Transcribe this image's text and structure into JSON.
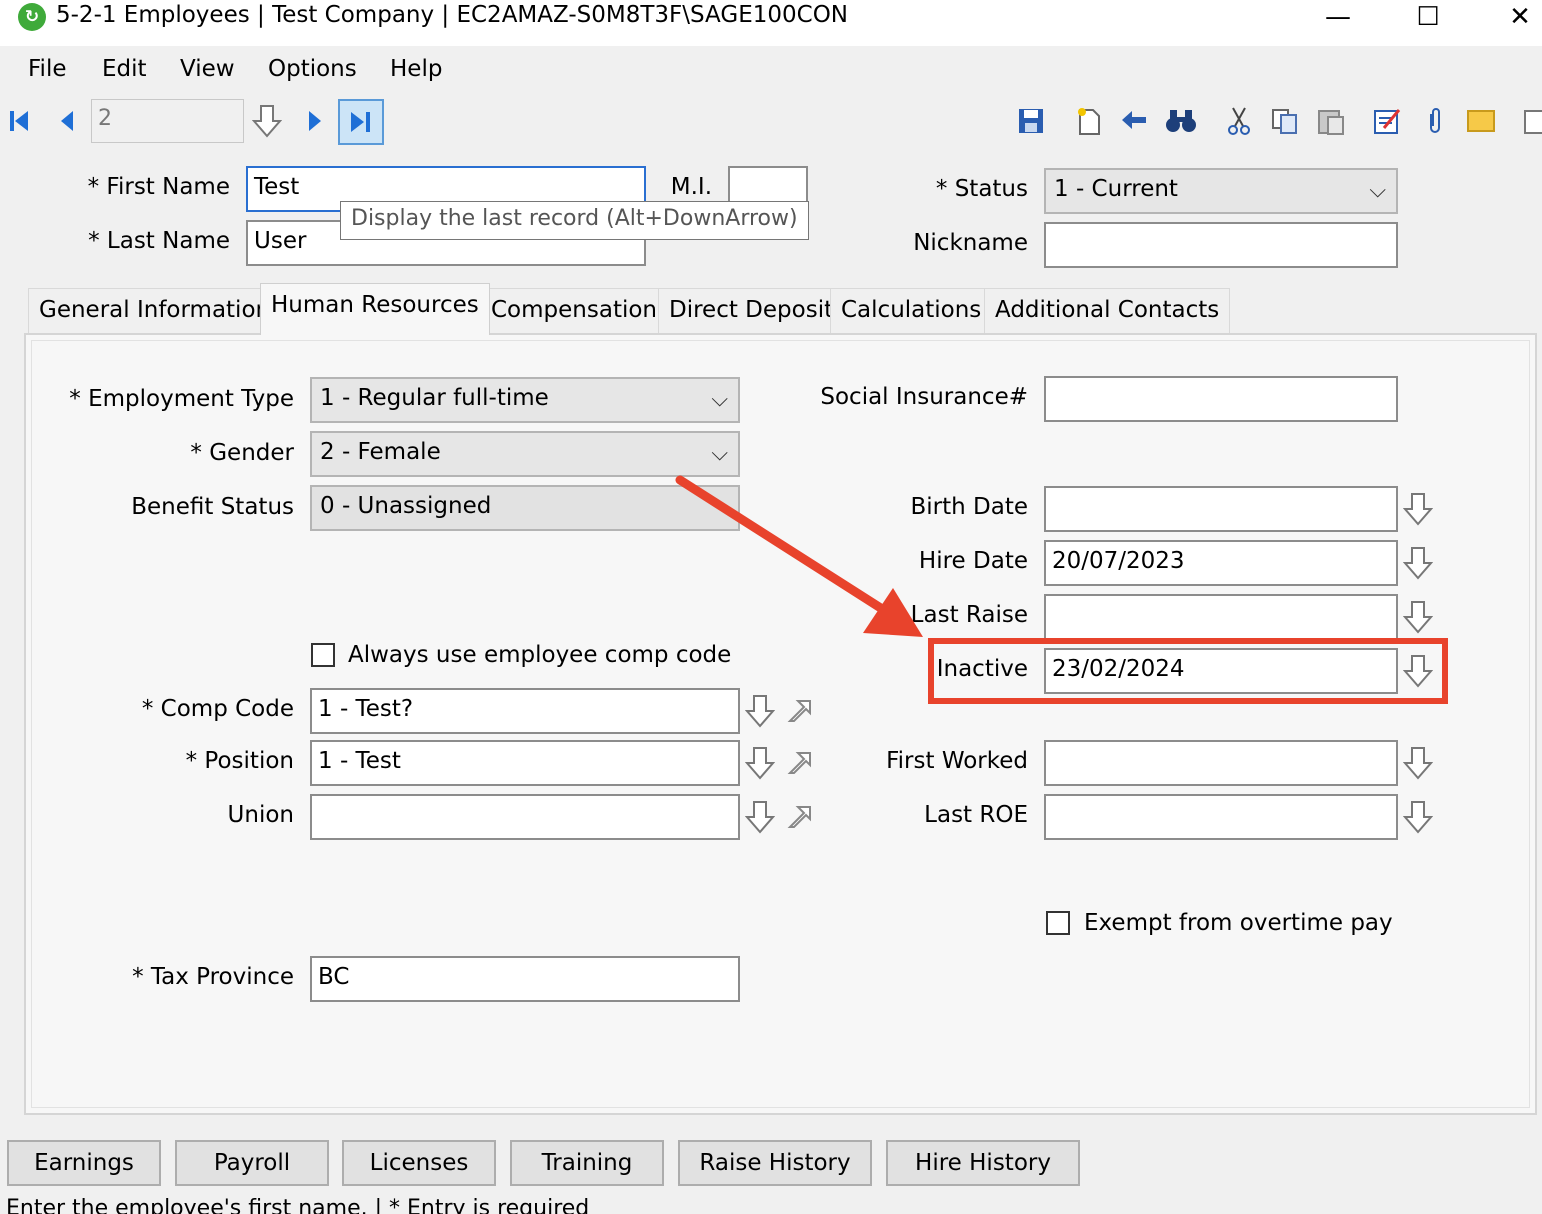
{
  "window": {
    "title": "5-2-1 Employees  |  Test Company  |  EC2AMAZ-S0M8T3F\\SAGE100CON",
    "minimize": "—",
    "maximize": "☐",
    "close": "✕"
  },
  "menu": [
    "File",
    "Edit",
    "View",
    "Options",
    "Help"
  ],
  "nav": {
    "record_number": "2"
  },
  "tooltip": "Display the last record  (Alt+DownArrow)",
  "header": {
    "first_name_label": "* First Name",
    "first_name_value": "Test",
    "mi_label": "M.I.",
    "mi_value": "",
    "last_name_label": "* Last Name",
    "last_name_value": "User",
    "status_label": "* Status",
    "status_value": "1 - Current",
    "nickname_label": "Nickname",
    "nickname_value": ""
  },
  "tabs": [
    "General Information",
    "Human Resources",
    "Compensation",
    "Direct Deposit",
    "Calculations",
    "Additional Contacts"
  ],
  "hr": {
    "employment_type_label": "* Employment Type",
    "employment_type_value": "1 - Regular full-time",
    "gender_label": "* Gender",
    "gender_value": "2 - Female",
    "benefit_status_label": "Benefit Status",
    "benefit_status_value": "0 - Unassigned",
    "always_use_comp_label": "Always use employee comp code",
    "comp_code_label": "* Comp Code",
    "comp_code_value": "1 - Test?",
    "position_label": "* Position",
    "position_value": "1 - Test",
    "union_label": "Union",
    "union_value": "",
    "tax_province_label": "* Tax Province",
    "tax_province_value": "BC",
    "sin_label": "Social Insurance#",
    "sin_value": "",
    "birth_date_label": "Birth Date",
    "birth_date_value": "",
    "hire_date_label": "Hire Date",
    "hire_date_value": "20/07/2023",
    "last_raise_label": "Last Raise",
    "last_raise_value": "",
    "inactive_label": "Inactive",
    "inactive_value": "23/02/2024",
    "first_worked_label": "First Worked",
    "first_worked_value": "",
    "last_roe_label": "Last ROE",
    "last_roe_value": "",
    "exempt_overtime_label": "Exempt from overtime pay"
  },
  "bottom_buttons": [
    "Earnings",
    "Payroll",
    "Licenses",
    "Training",
    "Raise History",
    "Hire History"
  ],
  "status_bar": "Enter the employee's first name.  |  * Entry is required",
  "colors": {
    "annotation": "#e8432c",
    "focus": "#2a6fd1",
    "nav_blue": "#1f6fd6"
  }
}
